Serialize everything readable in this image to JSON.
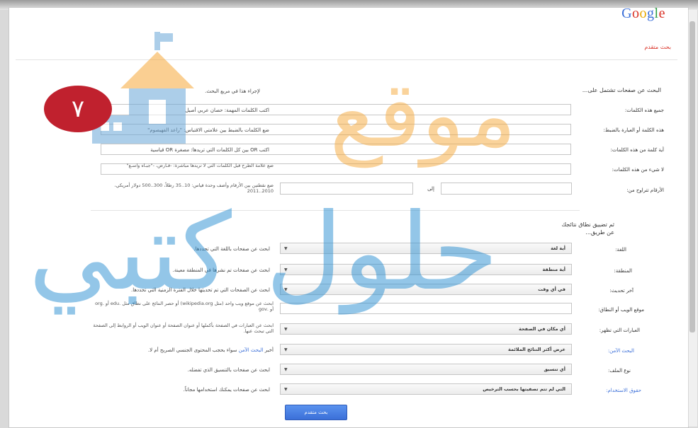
{
  "logo": "Google",
  "page_title": "بحث متقدم",
  "badge": "٧",
  "watermark": {
    "top": "موقع",
    "bottom": "حلول كتبي"
  },
  "section1": {
    "heading": "البحث عن صفحات تشتمل على...",
    "hint": "لإجراء هذا في مربع البحث.",
    "rows": [
      {
        "label": "جميع هذه الكلمات:",
        "hint": "اكتب الكلمات المهمة: حصان عربي أصيل"
      },
      {
        "label": "هذه الكلمة أو العبارة بالضبط:",
        "hint": "ضع الكلمات بالضبط بين علامتي الاقتباس: \"راعد الفهيصوم\""
      },
      {
        "label": "أية كلمة من هذه الكلمات:",
        "hint": "اكتب OR بين كل الكلمات التي تريدها: مصغرة OR قياسية"
      },
      {
        "label": "لا شيء من هذه الكلمات:",
        "hint": "ضع علامة الطرح قبل الكلمات التي لا تريدها مباشرة: -قـارض، -\"جبـاه واسـع\""
      },
      {
        "label": "الأرقام تتراوح من:",
        "hint": "ضع نقطتين بين الأرقام وأضف وحدة قياس: 10..35 رطلاً، 300..500 دولار أمريكي، 2010..2011",
        "between": "إلى"
      }
    ]
  },
  "section2": {
    "heading": "ثم تضييق نطاق نتائجك عن طريق...",
    "rows": [
      {
        "label": "اللغة:",
        "value": "أية لغة",
        "hint": "ابحث عن صفحات باللغة التي تحددها."
      },
      {
        "label": "المنطقة:",
        "value": "أية منطقة",
        "hint": "ابحث عن صفحات تم نشرها في المنطقة معينة."
      },
      {
        "label": "آخر تحديث:",
        "value": "في أي وقت",
        "hint": "ابحث عن الصفحات التي تم تحديثها خلال الفترة الزمنية التي تحددها."
      },
      {
        "label": "موقع الويب أو النطاق:",
        "hint": "ابحث عن موقع ويب واحد (مثل wikipedia.org) أو حصر النتائج على نطاق مثل .edu أو .org أو .gov"
      },
      {
        "label": "العبارات التي تظهر:",
        "value": "أي مكان في الصفحة",
        "hint": "ابحث عن العبارات في الصفحة بأكملها أو عنوان الصفحة أو عنوان الويب أو الروابط إلى الصفحة التي تبحث عنها."
      },
      {
        "label": "البحث الآمن:",
        "value": "عرض أكثر النتائج الملائمة",
        "hint_pre": "أخبر ",
        "hint_link": "البحث الآمن",
        "hint_post": " سواء بحجب المحتوى الجنسي الصريح أم لا."
      },
      {
        "label": "نوع الملف:",
        "value": "أي تنسيق",
        "hint": "ابحث عن صفحات بالتنسيق الذي تفضله."
      },
      {
        "label": "حقوق الاستخدام:",
        "value": "التي لم تتم تصفيتها بحسب الترخيص",
        "hint": "ابحث عن صفحات يمكنك استخدامها مجاناً."
      }
    ]
  },
  "submit_label": "بحث متقدم",
  "colors": {
    "accent": "#3b6fd8",
    "title_red": "#d93025",
    "badge_red": "#c0212e",
    "watermark_orange": "#f7a93a",
    "watermark_blue": "#2a8fd2"
  }
}
